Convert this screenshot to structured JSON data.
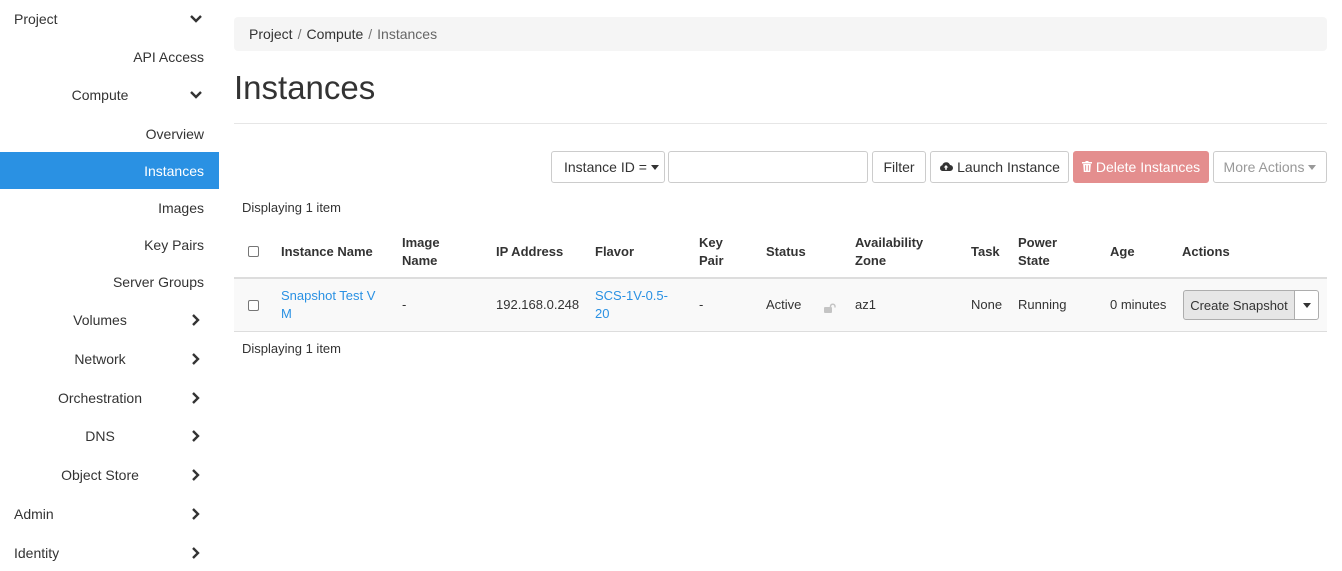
{
  "sidebar": {
    "items": [
      {
        "label": "Project",
        "icon": "chevron-down-icon"
      },
      {
        "label": "API Access"
      },
      {
        "label": "Compute",
        "icon": "chevron-down-icon"
      },
      {
        "label": "Overview"
      },
      {
        "label": "Instances",
        "active": true
      },
      {
        "label": "Images"
      },
      {
        "label": "Key Pairs"
      },
      {
        "label": "Server Groups"
      },
      {
        "label": "Volumes",
        "icon": "chevron-right-icon"
      },
      {
        "label": "Network",
        "icon": "chevron-right-icon"
      },
      {
        "label": "Orchestration",
        "icon": "chevron-right-icon"
      },
      {
        "label": "DNS",
        "icon": "chevron-right-icon"
      },
      {
        "label": "Object Store",
        "icon": "chevron-right-icon"
      },
      {
        "label": "Admin",
        "icon": "chevron-right-icon"
      },
      {
        "label": "Identity",
        "icon": "chevron-right-icon"
      }
    ]
  },
  "breadcrumb": {
    "items": [
      "Project",
      "Compute",
      "Instances"
    ],
    "separator": "/"
  },
  "page": {
    "title": "Instances"
  },
  "toolbar": {
    "filter_field_label": "Instance ID =",
    "filter_input_value": "",
    "filter_button": "Filter",
    "launch_button": "Launch Instance",
    "delete_button": "Delete Instances",
    "more_actions_button": "More Actions"
  },
  "table": {
    "count_text": "Displaying 1 item",
    "columns": [
      {
        "label": "Instance Name"
      },
      {
        "label": "Image\nName"
      },
      {
        "label": "IP Address"
      },
      {
        "label": "Flavor"
      },
      {
        "label": "Key\nPair"
      },
      {
        "label": "Status"
      },
      {
        "label": "Availability\nZone"
      },
      {
        "label": "Task"
      },
      {
        "label": "Power\nState"
      },
      {
        "label": "Age"
      },
      {
        "label": "Actions"
      }
    ],
    "rows": [
      {
        "instance_name": "Snapshot Test V\nM",
        "image_name": "-",
        "ip_address": "192.168.0.248",
        "flavor": "SCS-1V-0.5-\n20",
        "key_pair": "-",
        "status": "Active",
        "availability_zone": "az1",
        "task": "None",
        "power_state": "Running",
        "age": "0 minutes",
        "action_label": "Create Snapshot"
      }
    ]
  },
  "colors": {
    "accent": "#2a91e3",
    "danger": "#e48e8e",
    "breadcrumb_bg": "#f5f5f5"
  }
}
